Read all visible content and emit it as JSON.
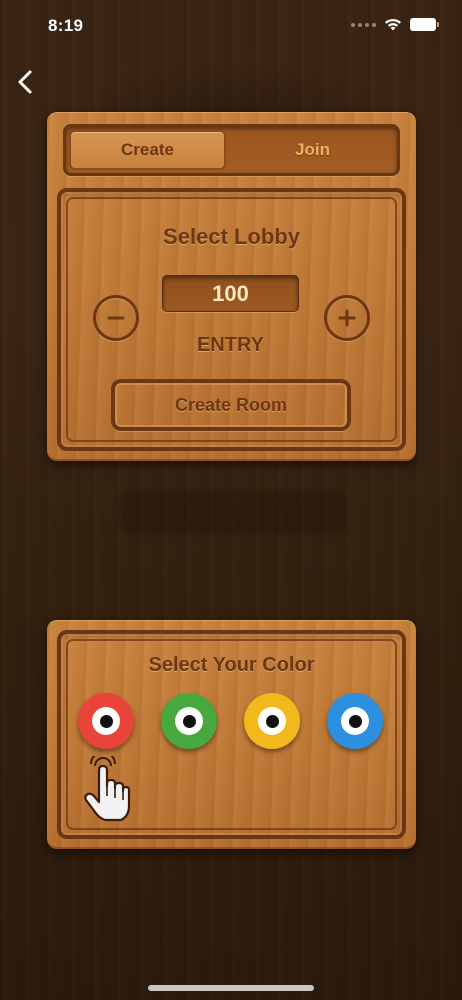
{
  "status_bar": {
    "time": "8:19"
  },
  "tabs": {
    "create": "Create",
    "join": "Join",
    "active": "Create"
  },
  "lobby": {
    "title": "Select Lobby",
    "entry_value": "100",
    "entry_label": "ENTRY",
    "create_room_label": "Create Room"
  },
  "color_select": {
    "title": "Select Your Color",
    "options": [
      {
        "name": "red",
        "color": "#e8443a"
      },
      {
        "name": "green",
        "color": "#46a83f"
      },
      {
        "name": "yellow",
        "color": "#f3b81b"
      },
      {
        "name": "blue",
        "color": "#2d8fe0"
      }
    ],
    "selected": "red"
  },
  "icons": {
    "back": "chevron-left-icon",
    "minus": "minus-circle-icon",
    "plus": "plus-circle-icon",
    "tap_hint": "tap-hand-icon",
    "wifi": "wifi-icon",
    "battery": "battery-icon"
  },
  "colors": {
    "wood_text": "#6e3713",
    "tab_inactive_text": "#f0b25e"
  }
}
